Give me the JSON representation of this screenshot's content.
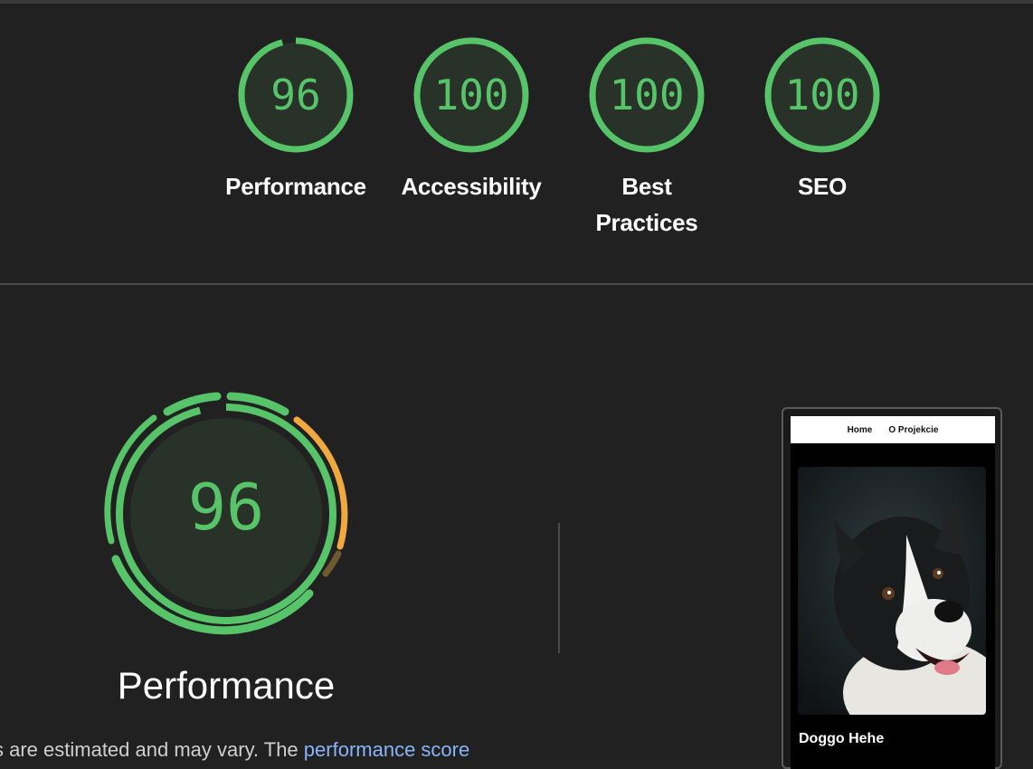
{
  "categories": [
    {
      "score": "96",
      "score_value": 96,
      "label": "Performance",
      "label_line2": ""
    },
    {
      "score": "100",
      "score_value": 100,
      "label": "Accessibility",
      "label_line2": ""
    },
    {
      "score": "100",
      "score_value": 100,
      "label": "Best",
      "label_line2": "Practices"
    },
    {
      "score": "100",
      "score_value": 100,
      "label": "SEO",
      "label_line2": ""
    }
  ],
  "performance": {
    "score": "96",
    "score_value": 96,
    "title": "Performance"
  },
  "footer_text": {
    "prefix": "s are estimated and may vary. The ",
    "link": "performance score"
  },
  "screenshot": {
    "nav_home": "Home",
    "nav_about": "O Projekcie",
    "heading": "Doggo Hehe"
  },
  "colors": {
    "pass": "#57c46a",
    "average": "#f0a93e",
    "background": "#212121"
  }
}
